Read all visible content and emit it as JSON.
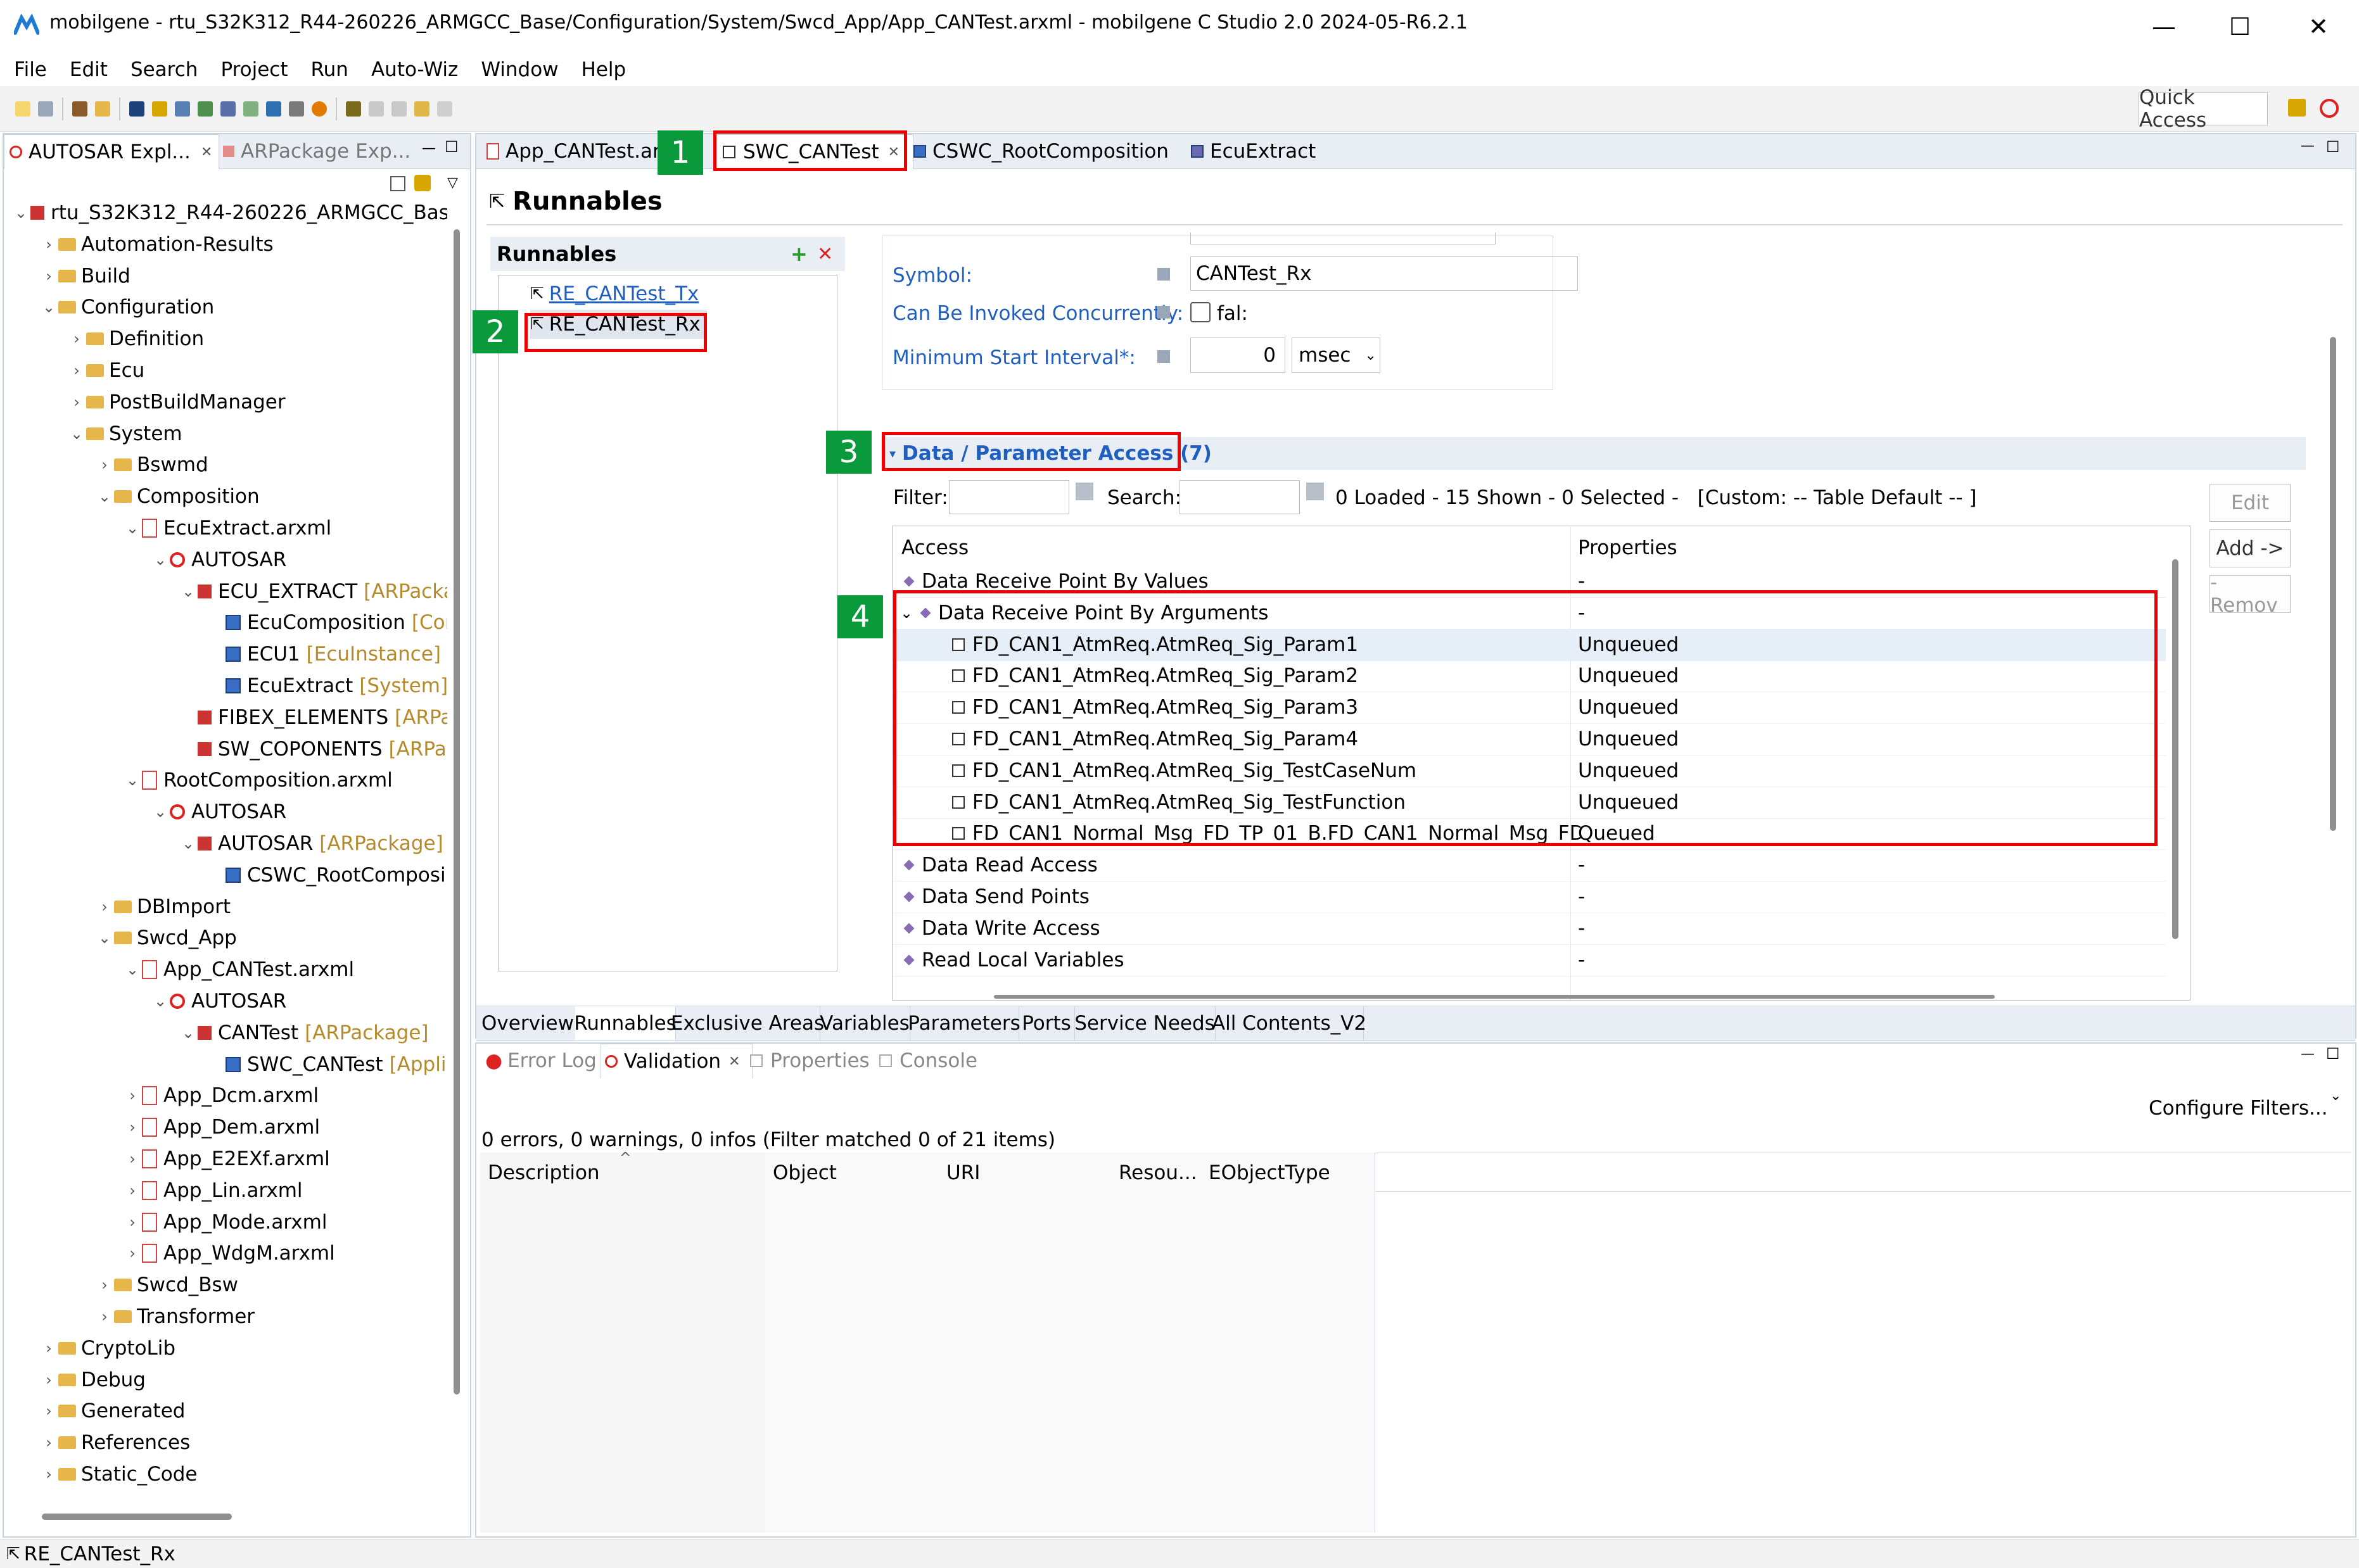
{
  "window": {
    "title": "mobilgene - rtu_S32K312_R44-260226_ARMGCC_Base/Configuration/System/Swcd_App/App_CANTest.arxml - mobilgene C Studio 2.0 2024-05-R6.2.1",
    "minimize": "—",
    "maximize": "☐",
    "close": "✕"
  },
  "menu": [
    "File",
    "Edit",
    "Search",
    "Project",
    "Run",
    "Auto-Wiz",
    "Window",
    "Help"
  ],
  "quick_access": "Quick Access",
  "left_panel": {
    "tabs": [
      "AUTOSAR Expl...",
      "ARPackage Exp..."
    ],
    "tree": [
      {
        "label": "rtu_S32K312_R44-260226_ARMGCC_Base",
        "depth": 0,
        "arrow": "⌄",
        "icon": "project"
      },
      {
        "label": "Automation-Results",
        "depth": 1,
        "arrow": "›",
        "icon": "folder"
      },
      {
        "label": "Build",
        "depth": 1,
        "arrow": "›",
        "icon": "folder"
      },
      {
        "label": "Configuration",
        "depth": 1,
        "arrow": "⌄",
        "icon": "folder"
      },
      {
        "label": "Definition",
        "depth": 2,
        "arrow": "›",
        "icon": "folder"
      },
      {
        "label": "Ecu",
        "depth": 2,
        "arrow": "›",
        "icon": "folder"
      },
      {
        "label": "PostBuildManager",
        "depth": 2,
        "arrow": "›",
        "icon": "folder"
      },
      {
        "label": "System",
        "depth": 2,
        "arrow": "⌄",
        "icon": "folder"
      },
      {
        "label": "Bswmd",
        "depth": 3,
        "arrow": "›",
        "icon": "folder"
      },
      {
        "label": "Composition",
        "depth": 3,
        "arrow": "⌄",
        "icon": "folder"
      },
      {
        "label": "EcuExtract.arxml",
        "depth": 4,
        "arrow": "⌄",
        "icon": "file"
      },
      {
        "label": "AUTOSAR",
        "depth": 5,
        "arrow": "⌄",
        "icon": "autosar"
      },
      {
        "label": "ECU_EXTRACT",
        "suffix": "[ARPacka",
        "depth": 6,
        "arrow": "⌄",
        "icon": "pkg"
      },
      {
        "label": "EcuComposition",
        "suffix": "[Cor",
        "depth": 7,
        "arrow": "",
        "icon": "comp"
      },
      {
        "label": "ECU1",
        "suffix": "[EcuInstance]",
        "depth": 7,
        "arrow": "",
        "icon": "comp"
      },
      {
        "label": "EcuExtract",
        "suffix": "[System]",
        "depth": 7,
        "arrow": "",
        "icon": "comp"
      },
      {
        "label": "FIBEX_ELEMENTS",
        "suffix": "[ARPa",
        "depth": 6,
        "arrow": "",
        "icon": "pkg"
      },
      {
        "label": "SW_COPONENTS",
        "suffix": "[ARPa",
        "depth": 6,
        "arrow": "",
        "icon": "pkg"
      },
      {
        "label": "RootComposition.arxml",
        "depth": 4,
        "arrow": "⌄",
        "icon": "file"
      },
      {
        "label": "AUTOSAR",
        "depth": 5,
        "arrow": "⌄",
        "icon": "autosar"
      },
      {
        "label": "AUTOSAR",
        "suffix": "[ARPackage]",
        "depth": 6,
        "arrow": "⌄",
        "icon": "pkg"
      },
      {
        "label": "CSWC_RootComposi",
        "depth": 7,
        "arrow": "",
        "icon": "comp"
      },
      {
        "label": "DBImport",
        "depth": 3,
        "arrow": "›",
        "icon": "folder"
      },
      {
        "label": "Swcd_App",
        "depth": 3,
        "arrow": "⌄",
        "icon": "folder"
      },
      {
        "label": "App_CANTest.arxml",
        "depth": 4,
        "arrow": "⌄",
        "icon": "file"
      },
      {
        "label": "AUTOSAR",
        "depth": 5,
        "arrow": "⌄",
        "icon": "autosar"
      },
      {
        "label": "CANTest",
        "suffix": "[ARPackage]",
        "depth": 6,
        "arrow": "⌄",
        "icon": "pkg"
      },
      {
        "label": "SWC_CANTest",
        "suffix": "[Appli",
        "depth": 7,
        "arrow": "",
        "icon": "comp"
      },
      {
        "label": "App_Dcm.arxml",
        "depth": 4,
        "arrow": "›",
        "icon": "file"
      },
      {
        "label": "App_Dem.arxml",
        "depth": 4,
        "arrow": "›",
        "icon": "file"
      },
      {
        "label": "App_E2EXf.arxml",
        "depth": 4,
        "arrow": "›",
        "icon": "file"
      },
      {
        "label": "App_Lin.arxml",
        "depth": 4,
        "arrow": "›",
        "icon": "file"
      },
      {
        "label": "App_Mode.arxml",
        "depth": 4,
        "arrow": "›",
        "icon": "file"
      },
      {
        "label": "App_WdgM.arxml",
        "depth": 4,
        "arrow": "›",
        "icon": "file"
      },
      {
        "label": "Swcd_Bsw",
        "depth": 3,
        "arrow": "›",
        "icon": "folder"
      },
      {
        "label": "Transformer",
        "depth": 3,
        "arrow": "›",
        "icon": "folder"
      },
      {
        "label": "CryptoLib",
        "depth": 1,
        "arrow": "›",
        "icon": "folder"
      },
      {
        "label": "Debug",
        "depth": 1,
        "arrow": "›",
        "icon": "folder"
      },
      {
        "label": "Generated",
        "depth": 1,
        "arrow": "›",
        "icon": "folder"
      },
      {
        "label": "References",
        "depth": 1,
        "arrow": "›",
        "icon": "folder"
      },
      {
        "label": "Static_Code",
        "depth": 1,
        "arrow": "›",
        "icon": "folder"
      }
    ]
  },
  "editor": {
    "tabs": [
      "App_CANTest.ar",
      "SWC_CANTest",
      "CSWC_RootComposition",
      "EcuExtract"
    ],
    "page_title": "Runnables",
    "runnables_header": "Runnables",
    "runnables": [
      "RE_CANTest_Tx",
      "RE_CANTest_Rx"
    ],
    "symbol_label": "Symbol:",
    "symbol_value": "CANTest_Rx",
    "concurrent_label": "Can Be Invoked Concurrently:",
    "concurrent_value": "fal:",
    "min_interval_label": "Minimum Start Interval*:",
    "min_interval_value": "0",
    "min_interval_unit": "msec",
    "section_title": "Data / Parameter Access (7)",
    "filter_label": "Filter:",
    "search_label": "Search:",
    "status": "0 Loaded - 15 Shown - 0 Selected -   [Custom: -- Table Default -- ]",
    "buttons": {
      "edit": "Edit",
      "add": "Add ->",
      "remove": "- Remov"
    },
    "table_headers": [
      "Access",
      "Properties"
    ],
    "rows": [
      {
        "access": "Data Receive Point By Values",
        "prop": "-",
        "indent": 0,
        "kind": "group"
      },
      {
        "access": "Data Receive Point By Arguments",
        "prop": "-",
        "indent": 0,
        "kind": "group-open"
      },
      {
        "access": "FD_CAN1_AtmReq.AtmReq_Sig_Param1",
        "prop": "Unqueued",
        "indent": 1,
        "kind": "item"
      },
      {
        "access": "FD_CAN1_AtmReq.AtmReq_Sig_Param2",
        "prop": "Unqueued",
        "indent": 1,
        "kind": "item"
      },
      {
        "access": "FD_CAN1_AtmReq.AtmReq_Sig_Param3",
        "prop": "Unqueued",
        "indent": 1,
        "kind": "item"
      },
      {
        "access": "FD_CAN1_AtmReq.AtmReq_Sig_Param4",
        "prop": "Unqueued",
        "indent": 1,
        "kind": "item"
      },
      {
        "access": "FD_CAN1_AtmReq.AtmReq_Sig_TestCaseNum",
        "prop": "Unqueued",
        "indent": 1,
        "kind": "item"
      },
      {
        "access": "FD_CAN1_AtmReq.AtmReq_Sig_TestFunction",
        "prop": "Unqueued",
        "indent": 1,
        "kind": "item"
      },
      {
        "access": "FD_CAN1_Normal_Msg_FD_TP_01_B.FD_CAN1_Normal_Msg_FD_",
        "prop": "Queued",
        "indent": 1,
        "kind": "item"
      },
      {
        "access": "Data Read Access",
        "prop": "-",
        "indent": 0,
        "kind": "group"
      },
      {
        "access": "Data Send Points",
        "prop": "-",
        "indent": 0,
        "kind": "group"
      },
      {
        "access": "Data Write Access",
        "prop": "-",
        "indent": 0,
        "kind": "group"
      },
      {
        "access": "Read Local Variables",
        "prop": "-",
        "indent": 0,
        "kind": "group"
      }
    ],
    "bottom_tabs": [
      "Overview",
      "Runnables",
      "Exclusive Areas",
      "Variables",
      "Parameters",
      "Ports",
      "Service Needs",
      "All Contents_V2"
    ]
  },
  "markers": [
    "1",
    "2",
    "3",
    "4"
  ],
  "validation": {
    "tabs": [
      "Error Log",
      "Validation",
      "Properties",
      "Console"
    ],
    "configure": "Configure Filters...",
    "summary": "0 errors, 0 warnings, 0 infos (Filter matched 0 of 21 items)",
    "columns": [
      "Description",
      "Object",
      "URI",
      "Resou...",
      "EObjectType"
    ]
  },
  "statusbar": {
    "text": "RE_CANTest_Rx"
  }
}
